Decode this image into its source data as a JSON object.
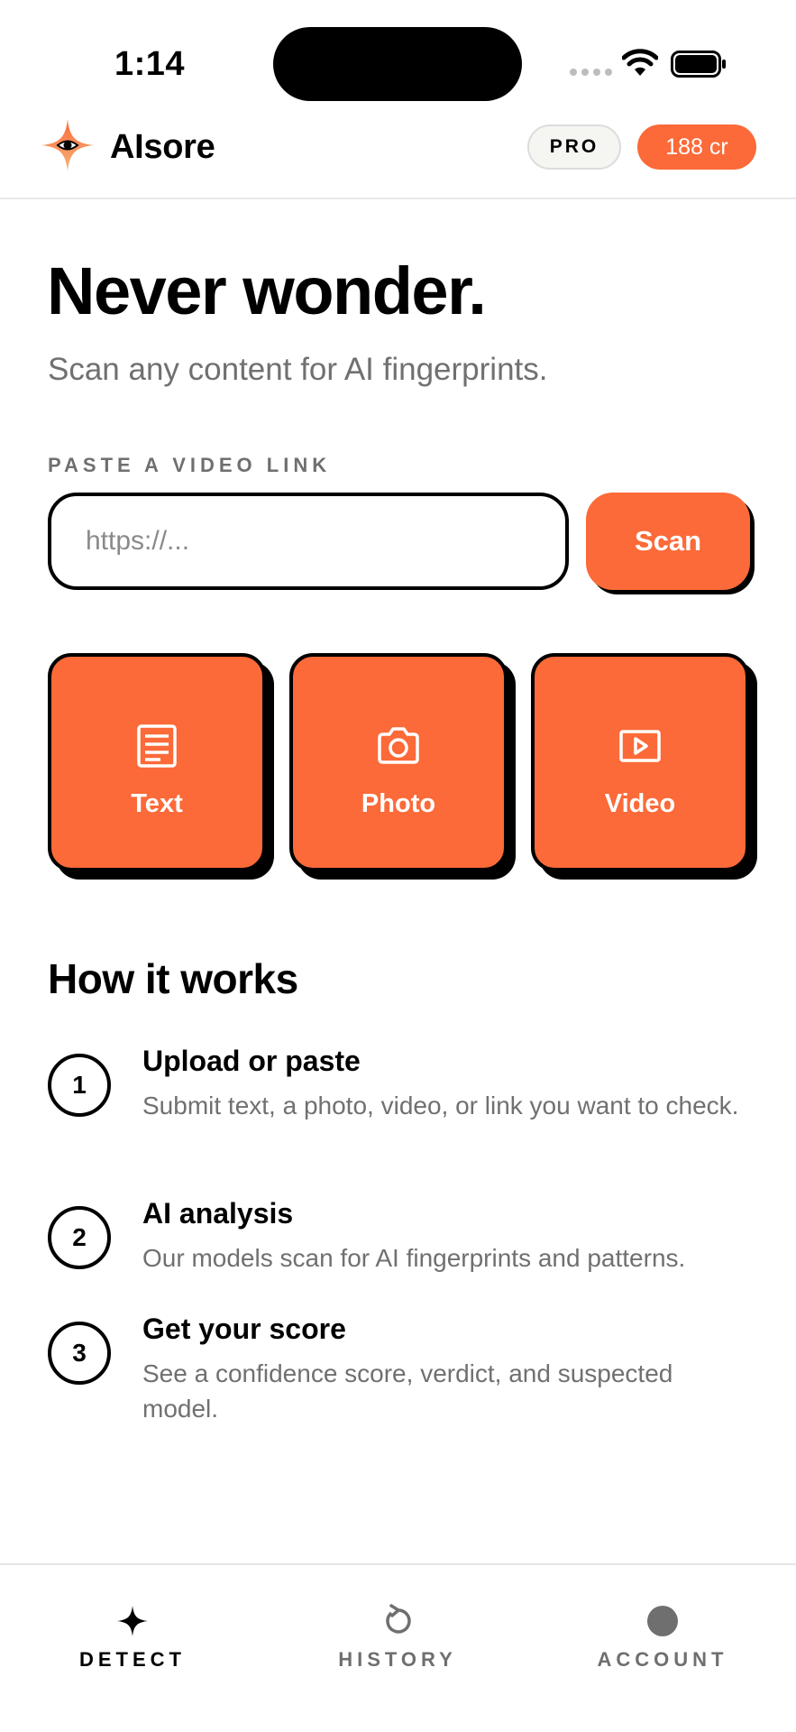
{
  "status_bar": {
    "time": "1:14"
  },
  "header": {
    "app_name": "AIsore",
    "plan_badge": "PRO",
    "credits": "188 cr"
  },
  "hero": {
    "title": "Never wonder.",
    "subtitle": "Scan any content for AI fingerprints."
  },
  "link_scan": {
    "label": "PASTE A VIDEO LINK",
    "placeholder": "https://...",
    "value": "",
    "button_label": "Scan"
  },
  "content_types": [
    {
      "label": "Text",
      "icon": "document-icon"
    },
    {
      "label": "Photo",
      "icon": "camera-icon"
    },
    {
      "label": "Video",
      "icon": "video-play-icon"
    }
  ],
  "how_it_works": {
    "title": "How it works",
    "steps": [
      {
        "number": "1",
        "title": "Upload or paste",
        "description": "Submit text, a photo, video, or link you want to check."
      },
      {
        "number": "2",
        "title": "AI analysis",
        "description": "Our models scan for AI fingerprints and patterns."
      },
      {
        "number": "3",
        "title": "Get your score",
        "description": "See a confidence score, verdict, and suspected model."
      }
    ]
  },
  "bottom_nav": {
    "items": [
      {
        "label": "DETECT",
        "icon": "sparkle-icon",
        "active": true
      },
      {
        "label": "HISTORY",
        "icon": "history-icon",
        "active": false
      },
      {
        "label": "ACCOUNT",
        "icon": "avatar-icon",
        "active": false
      }
    ]
  },
  "colors": {
    "accent": "#fb6a38",
    "text_primary": "#000000",
    "text_secondary": "#707070",
    "border": "#e8e8e8"
  }
}
